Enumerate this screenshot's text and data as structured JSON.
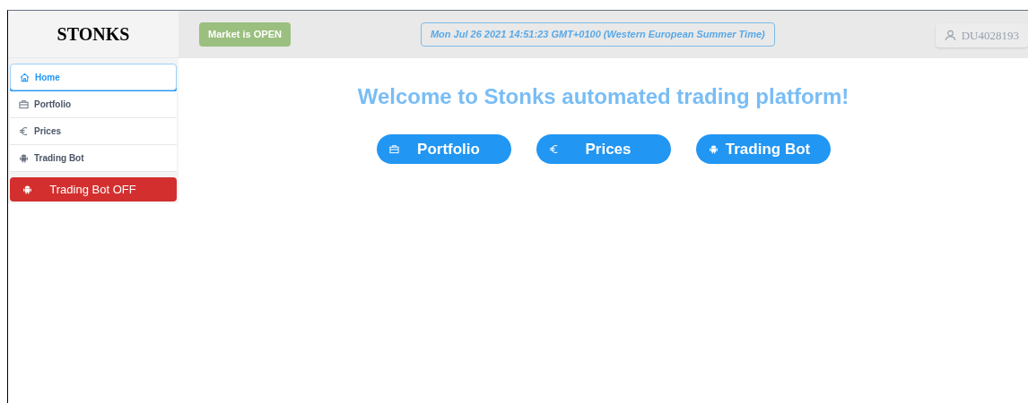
{
  "brand": "STONKS",
  "market_status": {
    "label": "Market is OPEN",
    "open": true
  },
  "clock": "Mon Jul 26 2021 14:51:23 GMT+0100 (Western European Summer Time)",
  "account": "DU4028193",
  "sidebar": {
    "items": [
      {
        "label": "Home",
        "selected": true
      },
      {
        "label": "Portfolio",
        "selected": false
      },
      {
        "label": "Prices",
        "selected": false
      },
      {
        "label": "Trading Bot",
        "selected": false
      }
    ]
  },
  "bot_toggle": {
    "label": "Trading Bot OFF",
    "on": false
  },
  "welcome": "Welcome to Stonks automated trading platform!",
  "shortcuts": [
    "Portfolio",
    "Prices",
    "Trading Bot"
  ]
}
